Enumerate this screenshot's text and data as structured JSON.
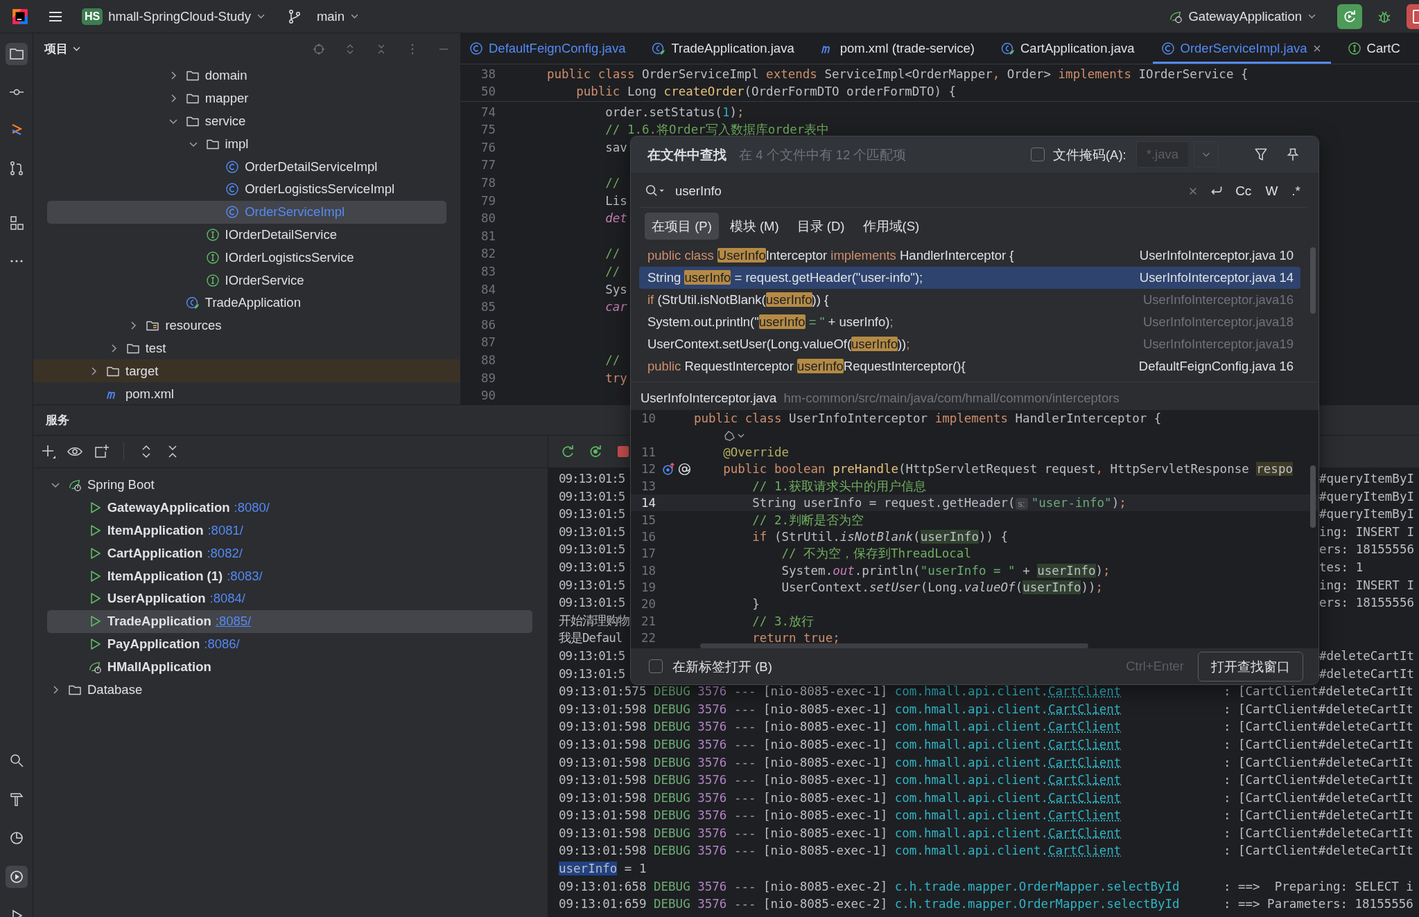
{
  "topbar": {
    "project_badge": "HS",
    "project": "hmall-SpringCloud-Study",
    "branch": "main",
    "run_config": "GatewayApplication"
  },
  "project_panel": {
    "title": "项目",
    "tree": [
      {
        "children": [
          {
            "children": [
              {
                "children": [
                  {
                    "children": [
                      {
                        "label": "domain",
                        "kind": "folder",
                        "expanded": false,
                        "selected": false,
                        "excluded": false
                      },
                      {
                        "label": "mapper",
                        "kind": "folder",
                        "expanded": false,
                        "selected": false,
                        "excluded": false
                      },
                      {
                        "label": "service",
                        "kind": "folder",
                        "expanded": true,
                        "selected": false,
                        "excluded": false,
                        "children": [
                          {
                            "label": "impl",
                            "kind": "folder",
                            "expanded": true,
                            "selected": false,
                            "excluded": false,
                            "children": [
                              {
                                "label": "OrderDetailServiceImpl",
                                "kind": "class",
                                "selected": false,
                                "excluded": false
                              },
                              {
                                "label": "OrderLogisticsServiceImpl",
                                "kind": "class",
                                "selected": false,
                                "excluded": false
                              },
                              {
                                "label": "OrderServiceImpl",
                                "kind": "class",
                                "selected": true,
                                "excluded": false
                              }
                            ]
                          },
                          {
                            "label": "IOrderDetailService",
                            "kind": "interface",
                            "selected": false,
                            "excluded": false
                          },
                          {
                            "label": "IOrderLogisticsService",
                            "kind": "interface",
                            "selected": false,
                            "excluded": false
                          },
                          {
                            "label": "IOrderService",
                            "kind": "interface",
                            "selected": false,
                            "excluded": false
                          }
                        ]
                      },
                      {
                        "label": "TradeApplication",
                        "kind": "springapp",
                        "selected": false,
                        "excluded": false
                      }
                    ]
                  }
                ]
              },
              {
                "label": "resources",
                "kind": "resfolder",
                "expanded": false,
                "selected": false,
                "excluded": false
              }
            ]
          },
          {
            "label": "test",
            "kind": "folder",
            "expanded": false,
            "selected": false,
            "excluded": false
          }
        ]
      },
      {
        "label": "target",
        "kind": "folder",
        "expanded": false,
        "selected": false,
        "excluded": true
      },
      {
        "label": "pom.xml",
        "kind": "pom",
        "selected": false,
        "excluded": false
      }
    ]
  },
  "editor": {
    "tabs": [
      {
        "label": "DefaultFeignConfig.java",
        "kind": "class",
        "modified": true,
        "selected": false
      },
      {
        "label": "TradeApplication.java",
        "kind": "springapp",
        "modified": false,
        "selected": false
      },
      {
        "label": "pom.xml (trade-service)",
        "kind": "pom",
        "modified": false,
        "selected": false
      },
      {
        "label": "CartApplication.java",
        "kind": "springapp",
        "modified": false,
        "selected": false
      },
      {
        "label": "OrderServiceImpl.java",
        "kind": "class",
        "modified": true,
        "selected": true
      },
      {
        "label": "CartC",
        "kind": "interface",
        "modified": false,
        "selected": false
      }
    ],
    "sticky_lines": [
      {
        "number": "38",
        "code": [
          {
            "text": "public class ",
            "kind": "keyword"
          },
          "OrderServiceImpl ",
          {
            "text": "extends ",
            "kind": "keyword"
          },
          "ServiceImpl<OrderMapper",
          {
            "text": ", ",
            "kind": "keyword"
          },
          "Order> ",
          {
            "text": "implements ",
            "kind": "keyword"
          },
          "IOrderService {"
        ]
      },
      {
        "number": "50",
        "code": [
          {
            "text": "    public ",
            "kind": "keyword"
          },
          "Long ",
          {
            "text": "createOrder",
            "kind": "function"
          },
          "(OrderFormDTO orderFormDTO) {"
        ]
      }
    ],
    "lines": [
      {
        "number": "74",
        "code": [
          "        order.setStatus(",
          {
            "text": "1",
            "kind": "number"
          },
          ")",
          {
            "text": ";",
            "kind": "keyword"
          }
        ]
      },
      {
        "number": "75",
        "code": [
          {
            "text": "        // 1.6.将Order写入数据库order表中",
            "kind": "comment"
          }
        ]
      },
      {
        "number": "76",
        "code": [
          "        sav"
        ]
      },
      {
        "number": "77"
      },
      {
        "number": "78",
        "code": [
          {
            "text": "        //",
            "kind": "comment"
          }
        ]
      },
      {
        "number": "79",
        "code": [
          "        Lis"
        ]
      },
      {
        "number": "80",
        "code": [
          {
            "text": "        det",
            "kind": "field"
          }
        ]
      },
      {
        "number": "81"
      },
      {
        "number": "82",
        "code": [
          {
            "text": "        //",
            "kind": "comment"
          }
        ]
      },
      {
        "number": "83",
        "code": [
          {
            "text": "        //",
            "kind": "comment"
          }
        ]
      },
      {
        "number": "84",
        "code": [
          "        Sys"
        ]
      },
      {
        "number": "85",
        "code": [
          {
            "text": "        car",
            "kind": "field"
          }
        ]
      },
      {
        "number": "86"
      },
      {
        "number": "87"
      },
      {
        "number": "88",
        "code": [
          {
            "text": "        //",
            "kind": "comment"
          }
        ]
      },
      {
        "number": "89",
        "code": [
          {
            "text": "        try",
            "kind": "keyword"
          }
        ]
      },
      {
        "number": "90"
      }
    ]
  },
  "find_popup": {
    "title": "在文件中查找",
    "summary": "在 4 个文件中有 12 个匹配项",
    "file_mask": {
      "label": "文件掩码(A):",
      "checked": false,
      "value": "*.java"
    },
    "query": "userInfo",
    "options": [
      {
        "label": "Cc",
        "on": false
      },
      {
        "label": "W",
        "on": false
      },
      {
        "label": ".*",
        "on": false
      }
    ],
    "scopes": [
      {
        "label": "在项目 (P)",
        "selected": true
      },
      {
        "label": "模块 (M)",
        "selected": false
      },
      {
        "label": "目录 (D)",
        "selected": false
      },
      {
        "label": "作用域(S)",
        "selected": false
      }
    ],
    "results": [
      {
        "code": [
          {
            "text": "public class ",
            "kind": "keyword"
          },
          {
            "text": "UserInfo",
            "kind": "match"
          },
          "Interceptor ",
          {
            "text": "implements",
            "kind": "keyword"
          },
          " HandlerInterceptor {"
        ],
        "file": "UserInfoInterceptor.java 10",
        "selected": false,
        "dimmed": false
      },
      {
        "code": [
          "String ",
          {
            "text": "userInfo",
            "kind": "match"
          },
          " = request.getHeader(\"user-info\");"
        ],
        "file": "UserInfoInterceptor.java 14",
        "selected": true,
        "dimmed": false
      },
      {
        "code": [
          {
            "text": "if",
            "kind": "keyword"
          },
          " (StrUtil.isNotBlank(",
          {
            "text": "userInfo",
            "kind": "match"
          },
          ")) {"
        ],
        "file": "UserInfoInterceptor.java16",
        "selected": false,
        "dimmed": true
      },
      {
        "code": [
          "System.out.println(\"",
          {
            "text": "userInfo",
            "kind": "match"
          },
          {
            "text": " = \"",
            "kind": "string"
          },
          " + userInfo)",
          {
            "text": ";",
            "kind": "keyword"
          }
        ],
        "file": "UserInfoInterceptor.java18",
        "selected": false,
        "dimmed": true
      },
      {
        "code": [
          "UserContext.setUser(Long.valueOf(",
          {
            "text": "userInfo",
            "kind": "match"
          },
          "))",
          {
            "text": ";",
            "kind": "keyword"
          }
        ],
        "file": "UserInfoInterceptor.java19",
        "selected": false,
        "dimmed": true
      },
      {
        "code": [
          {
            "text": "public",
            "kind": "keyword"
          },
          " RequestInterceptor ",
          {
            "text": "userInfo",
            "kind": "match"
          },
          "RequestInterceptor(){"
        ],
        "file": "DefaultFeignConfig.java 16",
        "selected": false,
        "dimmed": false
      }
    ],
    "preview": {
      "file": "UserInfoInterceptor.java",
      "path": "hm-common/src/main/java/com/hmall/common/interceptors",
      "lines": [
        {
          "kind": "code",
          "number": "10",
          "current": false,
          "code": [
            {
              "text": "public class ",
              "kind": "keyword"
            },
            "UserInfoInterceptor ",
            {
              "text": "implements",
              "kind": "keyword"
            },
            " HandlerInterceptor {"
          ]
        },
        {
          "kind": "inlay",
          "current": false
        },
        {
          "kind": "code",
          "number": "11",
          "current": false,
          "code": [
            {
              "text": "    @Override",
              "kind": "annotation"
            }
          ]
        },
        {
          "kind": "code",
          "number": "12",
          "current": false,
          "marker": true,
          "code": [
            {
              "text": "    public boolean ",
              "kind": "keyword"
            },
            {
              "text": "preHandle",
              "kind": "function"
            },
            "(HttpServletRequest request",
            {
              "text": ", ",
              "kind": "keyword"
            },
            "HttpServletResponse ",
            {
              "text": "respo",
              "kind": "warning"
            }
          ]
        },
        {
          "kind": "code",
          "number": "13",
          "current": false,
          "code": [
            {
              "text": "        // 1.获取请求头中的用户信息",
              "kind": "comment"
            }
          ]
        },
        {
          "kind": "code",
          "number": "14",
          "current": true,
          "code": [
            "        String userInfo = request.getHeader(",
            {
              "text": "s:",
              "kind": "hint"
            },
            {
              "text": "\"user-info\"",
              "kind": "string"
            },
            ")",
            {
              "text": ";",
              "kind": "keyword"
            }
          ]
        },
        {
          "kind": "code",
          "number": "15",
          "current": false,
          "code": [
            {
              "text": "        // 2.判断是否为空",
              "kind": "comment"
            }
          ]
        },
        {
          "kind": "code",
          "number": "16",
          "current": false,
          "code": [
            {
              "text": "        if",
              "kind": "keyword"
            },
            " (StrUtil.",
            {
              "text": "isNotBlank",
              "kind": "static"
            },
            "(",
            {
              "text": "userInfo",
              "kind": "usage"
            },
            ")) {"
          ]
        },
        {
          "kind": "code",
          "number": "17",
          "current": false,
          "code": [
            {
              "text": "            // 不为空，保存到ThreadLocal",
              "kind": "comment"
            }
          ]
        },
        {
          "kind": "code",
          "number": "18",
          "current": false,
          "code": [
            "            System.",
            {
              "text": "out",
              "kind": "field"
            },
            ".println(",
            {
              "text": "\"userInfo = \"",
              "kind": "string"
            },
            " + ",
            {
              "text": "userInfo",
              "kind": "usage"
            },
            ")",
            {
              "text": ";",
              "kind": "keyword"
            }
          ]
        },
        {
          "kind": "code",
          "number": "19",
          "current": false,
          "code": [
            "            UserContext.",
            {
              "text": "setUser",
              "kind": "static"
            },
            "(Long.",
            {
              "text": "valueOf",
              "kind": "static"
            },
            "(",
            {
              "text": "userInfo",
              "kind": "usage"
            },
            "))",
            {
              "text": ";",
              "kind": "keyword"
            }
          ]
        },
        {
          "kind": "code",
          "number": "20",
          "current": false,
          "code": [
            "        }"
          ]
        },
        {
          "kind": "code",
          "number": "21",
          "current": false,
          "code": [
            {
              "text": "        // 3.放行",
              "kind": "comment"
            }
          ]
        },
        {
          "kind": "code",
          "number": "22",
          "current": false,
          "code": [
            {
              "text": "        return true;",
              "kind": "keyword"
            }
          ]
        }
      ]
    },
    "open_in_new_tab": {
      "label": "在新标签打开 (B)",
      "checked": false
    },
    "shortcut": "Ctrl+Enter",
    "open_button": "打开查找窗口"
  },
  "services": {
    "title": "服务",
    "tree": [
      {
        "label": "Spring Boot",
        "kind": "spring",
        "expanded": true,
        "selected": false,
        "children": [
          {
            "label": "GatewayApplication",
            "port": ":8080/",
            "kind": "run",
            "selected": false
          },
          {
            "label": "ItemApplication",
            "port": ":8081/",
            "kind": "run",
            "selected": false
          },
          {
            "label": "CartApplication",
            "port": ":8082/",
            "kind": "run",
            "selected": false
          },
          {
            "label": "ItemApplication (1)",
            "port": ":8083/",
            "kind": "run",
            "selected": false
          },
          {
            "label": "UserApplication",
            "port": ":8084/",
            "kind": "run",
            "selected": false
          },
          {
            "label": "TradeApplication",
            "port": ":8085/",
            "kind": "run",
            "selected": true
          },
          {
            "label": "PayApplication",
            "port": ":8086/",
            "kind": "run",
            "selected": false
          },
          {
            "label": "HMallApplication",
            "kind": "spring",
            "selected": false
          }
        ]
      },
      {
        "label": "Database",
        "kind": "folder",
        "expanded": false,
        "selected": false
      }
    ]
  },
  "console": {
    "lines": [
      {
        "kind": "covered",
        "start": "09:13:01:5",
        "end": "#queryItemByI"
      },
      {
        "kind": "covered",
        "start": "09:13:01:5",
        "end": "#queryItemByI"
      },
      {
        "kind": "covered",
        "start": "09:13:01:5",
        "end": "#queryItemByI"
      },
      {
        "kind": "covered",
        "start": "09:13:01:5",
        "end": "ing: INSERT I"
      },
      {
        "kind": "covered",
        "start": "09:13:01:5",
        "end": "ers: 18155556"
      },
      {
        "kind": "covered",
        "start": "09:13:01:5",
        "end": "tes: 1"
      },
      {
        "kind": "covered",
        "start": "09:13:01:5",
        "end": "ing: INSERT I"
      },
      {
        "kind": "covered",
        "start": "09:13:01:5",
        "end": "ers: 18155556"
      },
      {
        "kind": "covered",
        "start": "开始清理购物"
      },
      {
        "kind": "covered",
        "start": "我是Defaul"
      },
      {
        "kind": "covered",
        "start": "09:13:01:5",
        "end": "#deleteCartIt"
      },
      {
        "kind": "covered",
        "start": "09:13:01:5",
        "end": "#deleteCartIt"
      },
      {
        "kind": "log",
        "time": "09:13:01:575",
        "level": "DEBUG",
        "pid": "3576",
        "sep": "---",
        "thread": "[nio-8085-exec-1]",
        "logger": "com.hmall.api.client.",
        "link": "CartClient",
        "message": ": [CartClient#deleteCartIt"
      },
      {
        "kind": "log",
        "time": "09:13:01:598",
        "level": "DEBUG",
        "pid": "3576",
        "sep": "---",
        "thread": "[nio-8085-exec-1]",
        "logger": "com.hmall.api.client.",
        "link": "CartClient",
        "message": ": [CartClient#deleteCartIt"
      },
      {
        "kind": "log",
        "time": "09:13:01:598",
        "level": "DEBUG",
        "pid": "3576",
        "sep": "---",
        "thread": "[nio-8085-exec-1]",
        "logger": "com.hmall.api.client.",
        "link": "CartClient",
        "message": ": [CartClient#deleteCartIt"
      },
      {
        "kind": "log",
        "time": "09:13:01:598",
        "level": "DEBUG",
        "pid": "3576",
        "sep": "---",
        "thread": "[nio-8085-exec-1]",
        "logger": "com.hmall.api.client.",
        "link": "CartClient",
        "message": ": [CartClient#deleteCartIt"
      },
      {
        "kind": "log",
        "time": "09:13:01:598",
        "level": "DEBUG",
        "pid": "3576",
        "sep": "---",
        "thread": "[nio-8085-exec-1]",
        "logger": "com.hmall.api.client.",
        "link": "CartClient",
        "message": ": [CartClient#deleteCartIt"
      },
      {
        "kind": "log",
        "time": "09:13:01:598",
        "level": "DEBUG",
        "pid": "3576",
        "sep": "---",
        "thread": "[nio-8085-exec-1]",
        "logger": "com.hmall.api.client.",
        "link": "CartClient",
        "message": ": [CartClient#deleteCartIt"
      },
      {
        "kind": "log",
        "time": "09:13:01:598",
        "level": "DEBUG",
        "pid": "3576",
        "sep": "---",
        "thread": "[nio-8085-exec-1]",
        "logger": "com.hmall.api.client.",
        "link": "CartClient",
        "message": ": [CartClient#deleteCartIt"
      },
      {
        "kind": "log",
        "time": "09:13:01:598",
        "level": "DEBUG",
        "pid": "3576",
        "sep": "---",
        "thread": "[nio-8085-exec-1]",
        "logger": "com.hmall.api.client.",
        "link": "CartClient",
        "message": ": [CartClient#deleteCartIt"
      },
      {
        "kind": "log",
        "time": "09:13:01:598",
        "level": "DEBUG",
        "pid": "3576",
        "sep": "---",
        "thread": "[nio-8085-exec-1]",
        "logger": "com.hmall.api.client.",
        "link": "CartClient",
        "message": ": [CartClient#deleteCartIt"
      },
      {
        "kind": "log",
        "time": "09:13:01:598",
        "level": "DEBUG",
        "pid": "3576",
        "sep": "---",
        "thread": "[nio-8085-exec-1]",
        "logger": "com.hmall.api.client.",
        "link": "CartClient",
        "message": ": [CartClient#deleteCartIt"
      },
      {
        "kind": "plain",
        "parts": [
          {
            "text": "userInfo",
            "selected": true
          },
          {
            "text": " = 1",
            "selected": false
          }
        ]
      },
      {
        "kind": "log",
        "time": "09:13:01:658",
        "level": "DEBUG",
        "pid": "3576",
        "sep": "---",
        "thread": "[nio-8085-exec-2]",
        "logger": "c.h.trade.mapper.OrderMapper.selectById",
        "message": ": ==>  Preparing: SELECT i"
      },
      {
        "kind": "log",
        "time": "09:13:01:659",
        "level": "DEBUG",
        "pid": "3576",
        "sep": "---",
        "thread": "[nio-8085-exec-2]",
        "logger": "c.h.trade.mapper.OrderMapper.selectById",
        "message": ": ==> Parameters: 18155556"
      }
    ]
  }
}
